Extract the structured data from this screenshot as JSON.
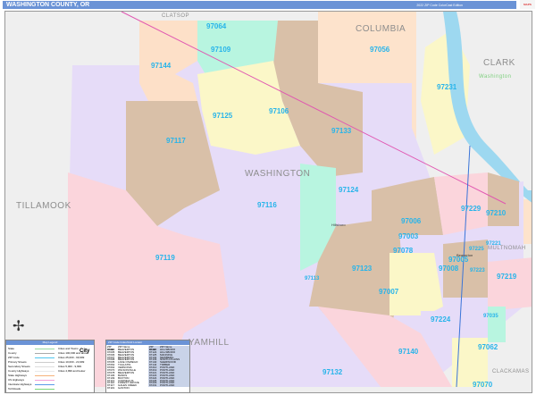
{
  "header": {
    "title": "WASHINGTON COUNTY, OR",
    "edition": "2022 ZIP Code ColorCast Edition",
    "logo": "MarketMAPS"
  },
  "counties": {
    "clatsop": "CLATSOP",
    "columbia": "COLUMBIA",
    "clark": "CLARK",
    "washington_wa": "Washington",
    "washington": "WASHINGTON",
    "tillamook": "TILLAMOOK",
    "multnomah": "MULTNOMAH",
    "yamhill": "YAMHILL",
    "clackamas": "CLACKAMAS"
  },
  "cities": {
    "hillsboro": "Hillsboro",
    "beaverton": "Beaverton"
  },
  "zips": {
    "z97064": "97064",
    "z97109": "97109",
    "z97056": "97056",
    "z97144": "97144",
    "z97231": "97231",
    "z97125": "97125",
    "z97106": "97106",
    "z97117": "97117",
    "z97133": "97133",
    "z97124": "97124",
    "z97116": "97116",
    "z97229": "97229",
    "z97210": "97210",
    "z97006": "97006",
    "z97003": "97003",
    "z97078": "97078",
    "z97225": "97225",
    "z97221": "97221",
    "z97005": "97005",
    "z97008": "97008",
    "z97223": "97223",
    "z97119": "97119",
    "z97123": "97123",
    "z97113": "97113",
    "z97007": "97007",
    "z97219": "97219",
    "z97224": "97224",
    "z97035": "97035",
    "z97062": "97062",
    "z97140": "97140",
    "z97132": "97132",
    "z97070": "97070"
  },
  "legend": {
    "title": "Map Legend",
    "lines": [
      "State",
      "County",
      "ZIP Code",
      "Primary Streets",
      "Secondary Streets",
      "County Highways",
      "State Highways",
      "US Highways",
      "Interstate Highways",
      "Toll Roads"
    ],
    "cities": [
      "Cities and Towns",
      "Cities 100,000 and above",
      "Cities 25,000 - 99,999",
      "Cities 10,000 - 24,999",
      "Cities 5,000 - 9,999",
      "Cities 4,999 and below"
    ],
    "city_sample": "City"
  },
  "zip_table": {
    "title": "ZIP Code Index/Grid Locator",
    "headers": [
      "ZIP Code",
      "ZIP Name"
    ],
    "left": [
      [
        "97003",
        "BEAVERTON"
      ],
      [
        "97005",
        "BEAVERTON"
      ],
      [
        "97006",
        "BEAVERTON"
      ],
      [
        "97007",
        "BEAVERTON"
      ],
      [
        "97008",
        "BEAVERTON"
      ],
      [
        "97035",
        "LAKE OSWEGO"
      ],
      [
        "97062",
        "TUALATIN"
      ],
      [
        "97064",
        "VERNONIA"
      ],
      [
        "97070",
        "WILSONVILLE"
      ],
      [
        "97078",
        "BEAVERTON"
      ],
      [
        "97106",
        "BANKS"
      ],
      [
        "97109",
        "BUXTON"
      ],
      [
        "97113",
        "CORNELIUS"
      ],
      [
        "97116",
        "FOREST GROVE"
      ],
      [
        "97117",
        "GALES CREEK"
      ],
      [
        "97119",
        "GASTON"
      ]
    ],
    "right": [
      [
        "97123",
        "HILLSBORO"
      ],
      [
        "97124",
        "HILLSBORO"
      ],
      [
        "97125",
        "MANNING"
      ],
      [
        "97132",
        "NEWBERG"
      ],
      [
        "97133",
        "NORTH PLAINS"
      ],
      [
        "97140",
        "SHERWOOD"
      ],
      [
        "97144",
        "TIMBER"
      ],
      [
        "97210",
        "PORTLAND"
      ],
      [
        "97219",
        "PORTLAND"
      ],
      [
        "97221",
        "PORTLAND"
      ],
      [
        "97223",
        "PORTLAND"
      ],
      [
        "97224",
        "PORTLAND"
      ],
      [
        "97225",
        "PORTLAND"
      ],
      [
        "97229",
        "PORTLAND"
      ],
      [
        "97231",
        "PORTLAND"
      ]
    ]
  }
}
